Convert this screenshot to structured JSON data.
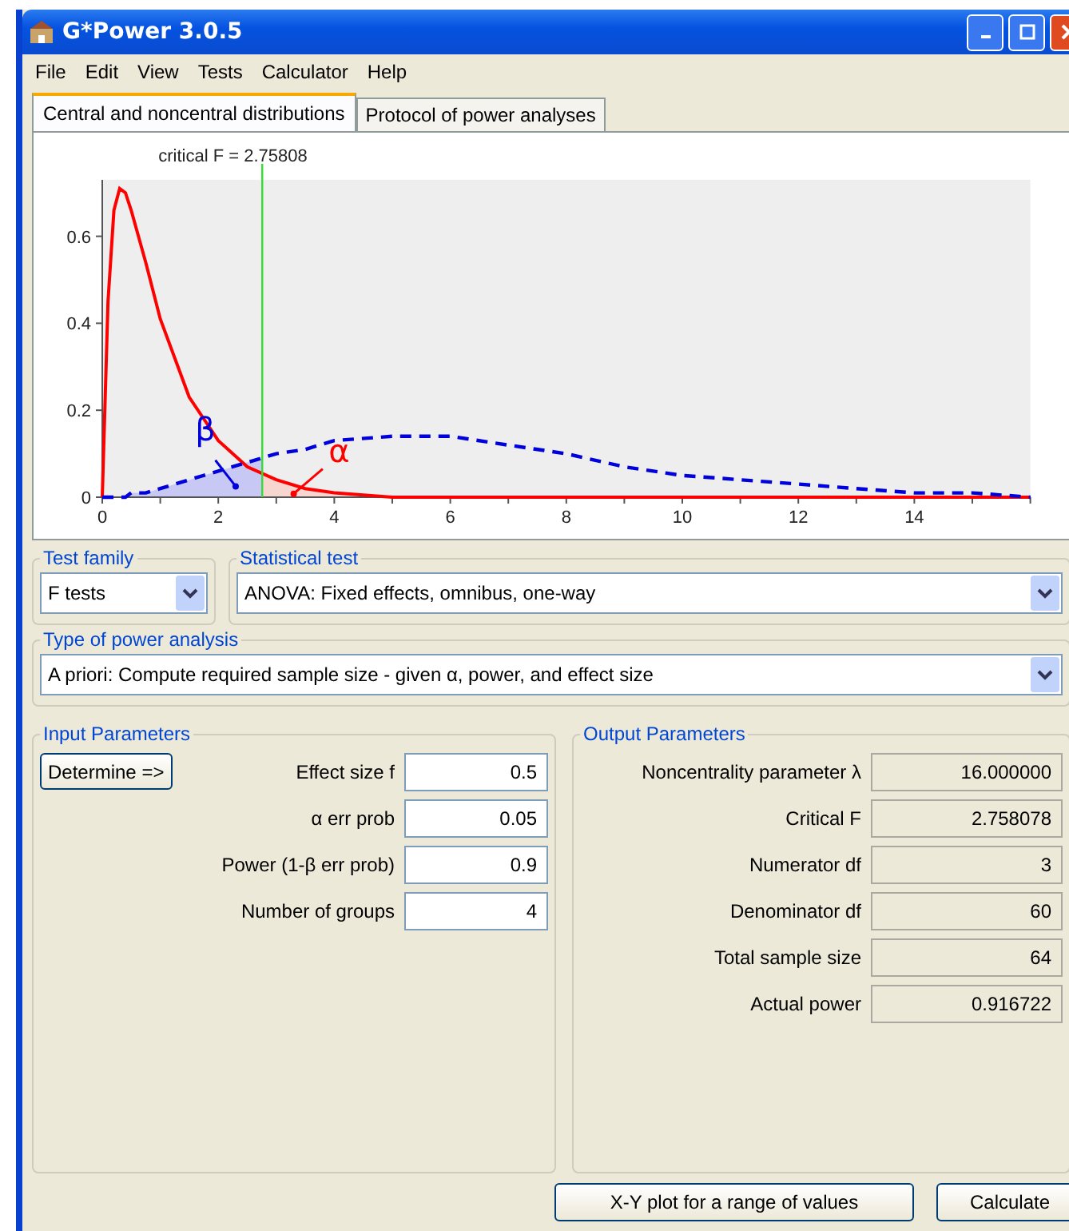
{
  "window": {
    "title": "G*Power 3.0.5"
  },
  "menu": [
    "File",
    "Edit",
    "View",
    "Tests",
    "Calculator",
    "Help"
  ],
  "tabs": [
    {
      "label": "Central and noncentral distributions",
      "selected": true
    },
    {
      "label": "Protocol of power analyses",
      "selected": false
    }
  ],
  "chart": {
    "chart_data": {
      "type": "line",
      "x": [
        0,
        0.1,
        0.2,
        0.3,
        0.4,
        0.5,
        0.75,
        1,
        1.5,
        2,
        2.5,
        3,
        3.5,
        4,
        5,
        6,
        7,
        8,
        9,
        10,
        11,
        12,
        13,
        14,
        15,
        16
      ],
      "series": [
        {
          "color": "#ff0000",
          "line_style": "solid",
          "values": [
            0,
            0.45,
            0.66,
            0.71,
            0.7,
            0.66,
            0.54,
            0.41,
            0.23,
            0.13,
            0.07,
            0.04,
            0.02,
            0.01,
            0,
            0,
            0,
            0,
            0,
            0,
            0,
            0,
            0,
            0,
            0,
            0
          ]
        },
        {
          "color": "#0000dd",
          "line_style": "dashed",
          "values": [
            0,
            0,
            0,
            0,
            0,
            0.01,
            0.01,
            0.02,
            0.04,
            0.06,
            0.08,
            0.1,
            0.11,
            0.13,
            0.14,
            0.14,
            0.12,
            0.1,
            0.07,
            0.05,
            0.04,
            0.03,
            0.02,
            0.01,
            0.01,
            0
          ]
        }
      ],
      "xlim": [
        0,
        16
      ],
      "ylim": [
        0,
        0.73
      ],
      "xticks": [
        0,
        2,
        4,
        6,
        8,
        10,
        12,
        14
      ],
      "yticks": [
        0,
        0.2,
        0.4,
        0.6
      ],
      "ref_lines": [
        {
          "axis": "x",
          "value": 2.75808,
          "color": "#33dd33"
        }
      ]
    },
    "critical_label": "critical F = 2.75808",
    "curve_labels": [
      {
        "text": "β",
        "color": "#0000dd"
      },
      {
        "text": "α",
        "color": "#ff0000"
      }
    ]
  },
  "test_family": {
    "legend": "Test family",
    "value": "F tests"
  },
  "statistical_test": {
    "legend": "Statistical test",
    "value": "ANOVA: Fixed effects, omnibus, one-way"
  },
  "type_of_power_analysis": {
    "legend": "Type of power analysis",
    "value": "A priori: Compute required sample size - given α, power, and effect size"
  },
  "input_parameters": {
    "legend": "Input Parameters",
    "determine_button": "Determine =>",
    "fields": [
      {
        "label": "Effect size f",
        "value": "0.5"
      },
      {
        "label": "α err prob",
        "value": "0.05"
      },
      {
        "label": "Power (1-β err prob)",
        "value": "0.9"
      },
      {
        "label": "Number of groups",
        "value": "4"
      }
    ]
  },
  "output_parameters": {
    "legend": "Output Parameters",
    "fields": [
      {
        "label": "Noncentrality parameter λ",
        "value": "16.000000"
      },
      {
        "label": "Critical F",
        "value": "2.758078"
      },
      {
        "label": "Numerator df",
        "value": "3"
      },
      {
        "label": "Denominator df",
        "value": "60"
      },
      {
        "label": "Total sample size",
        "value": "64"
      },
      {
        "label": "Actual power",
        "value": "0.916722"
      }
    ]
  },
  "buttons": [
    "X-Y plot for a range of values",
    "Calculate"
  ]
}
